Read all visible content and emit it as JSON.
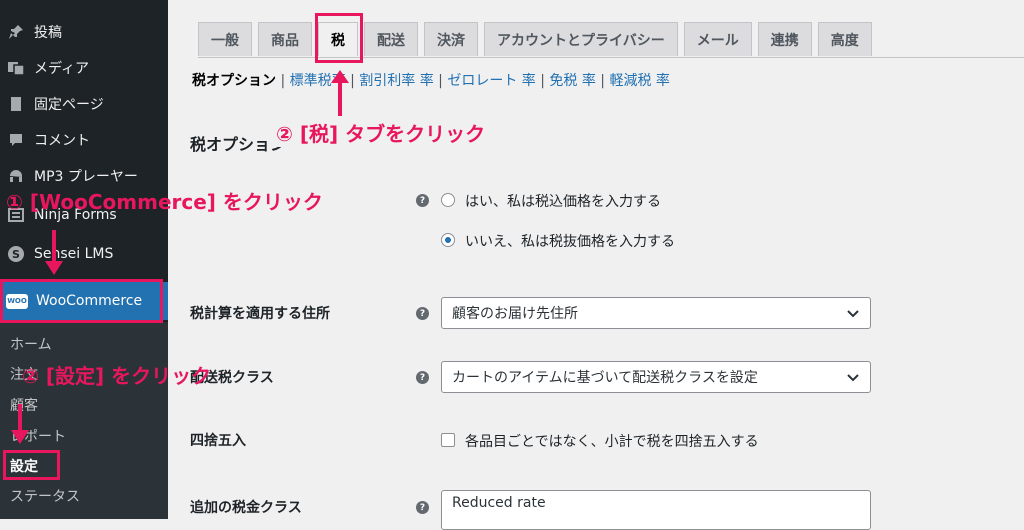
{
  "sidebar": {
    "items": [
      {
        "label": "投稿",
        "icon": "pin-icon"
      },
      {
        "label": "メディア",
        "icon": "media-icon"
      },
      {
        "label": "固定ページ",
        "icon": "page-icon"
      },
      {
        "label": "コメント",
        "icon": "comment-icon"
      },
      {
        "label": "MP3 プレーヤー",
        "icon": "audio-icon"
      },
      {
        "label": "Ninja Forms",
        "icon": "form-icon"
      },
      {
        "label": "Sensei LMS",
        "icon": "sensei-icon"
      }
    ],
    "woocommerce": {
      "label": "WooCommerce",
      "logo_text": "WOO"
    },
    "submenu": [
      "ホーム",
      "注文",
      "顧客",
      "レポート",
      "設定",
      "ステータス"
    ]
  },
  "tabs": [
    "一般",
    "商品",
    "税",
    "配送",
    "決済",
    "アカウントとプライバシー",
    "メール",
    "連携",
    "高度"
  ],
  "subsub": {
    "current": "税オプション",
    "links": [
      "標準税率",
      "割引利率 率",
      "ゼロレート 率",
      "免税 率",
      "軽減税 率"
    ]
  },
  "section_title": "税オプション",
  "rows": {
    "prices_radio": [
      "はい、私は税込価格を入力する",
      "いいえ、私は税抜価格を入力する"
    ],
    "calc_address": {
      "label": "税計算を適用する住所",
      "value": "顧客のお届け先住所"
    },
    "shipping_class": {
      "label": "配送税クラス",
      "value": "カートのアイテムに基づいて配送税クラスを設定"
    },
    "rounding": {
      "label": "四捨五入",
      "option": "各品目ごとではなく、小計で税を四捨五入する"
    },
    "additional": {
      "label": "追加の税金クラス",
      "value": "Reduced rate"
    }
  },
  "annotations": {
    "step1": "① [WooCommerce] をクリック",
    "step2": "② [設定] をクリック",
    "step3": "② [税] タブをクリック"
  },
  "colors": {
    "sidebar": "#1d2327",
    "accent": "#2271b1",
    "annotation": "#e8175d"
  }
}
